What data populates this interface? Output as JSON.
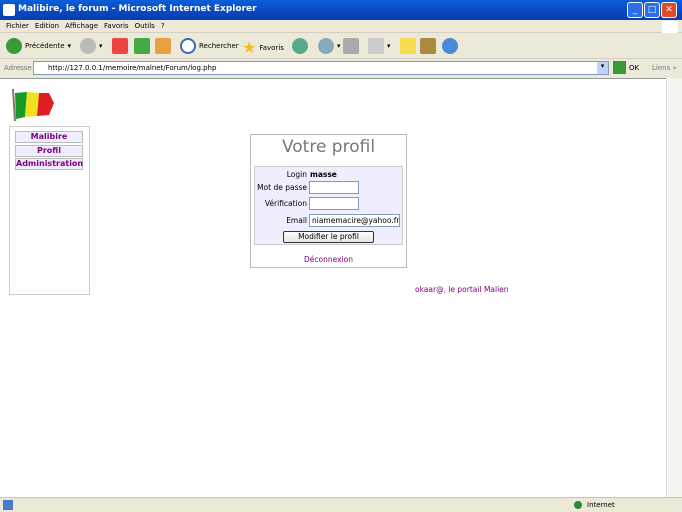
{
  "window": {
    "title": "Malibire, le forum - Microsoft Internet Explorer"
  },
  "menu": [
    "Fichier",
    "Edition",
    "Affichage",
    "Favoris",
    "Outils",
    "?"
  ],
  "toolbar": {
    "back": "Précédente",
    "search": "Rechercher",
    "favorites": "Favoris"
  },
  "address": {
    "label": "Adresse",
    "url": "http://127.0.0.1/memoire/malnet/Forum/log.php",
    "go": "OK",
    "links": "Liens"
  },
  "sidebar": {
    "items": [
      "Malibire",
      "Profil",
      "Administration"
    ]
  },
  "profile": {
    "title": "Votre profil",
    "login_label": "Login",
    "login_value": "masse",
    "password_label": "Mot de passe",
    "password_value": "",
    "verify_label": "Vérification",
    "verify_value": "",
    "email_label": "Email",
    "email_value": "niamemacire@yahoo.fr",
    "submit": "Modifier le profil",
    "logout": "Déconnexion"
  },
  "footer": {
    "link": "okaar@, le portail Malien"
  },
  "status": {
    "zone": "Internet"
  }
}
